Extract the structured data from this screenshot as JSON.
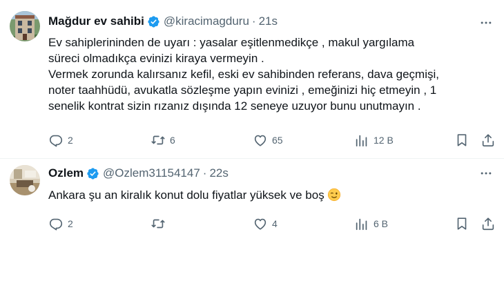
{
  "tweets": [
    {
      "name": "Mağdur ev sahibi",
      "handle": "@kiracimagduru",
      "time": "21s",
      "lines": [
        "Ev sahiplerininden de uyarı : yasalar eşitlenmedikçe , makul yargılama",
        "süreci olmadıkça evinizi kiraya vermeyin .",
        "Vermek zorunda kalırsanız kefil, eski ev sahibinden referans, dava geçmişi,",
        "noter taahhüdü, avukatla sözleşme yapın evinizi , emeğinizi hiç etmeyin , 1",
        "senelik kontrat sizin rızanız dışında 12 seneye uzuyor bunu unutmayın ."
      ],
      "replies": "2",
      "reposts": "6",
      "likes": "65",
      "views": "12 B",
      "avatar_icon": "building-avatar"
    },
    {
      "name": "Ozlem",
      "handle": "@Ozlem31154147",
      "time": "22s",
      "lines": [
        "Ankara şu an kiralık konut dolu fiyatlar yüksek ve boş"
      ],
      "emoji": "winking-face-emoji",
      "replies": "2",
      "reposts": "",
      "likes": "4",
      "views": "6 B",
      "avatar_icon": "room-avatar"
    }
  ],
  "colors": {
    "text": "#0f1419",
    "secondary": "#536471",
    "verified": "#1d9bf0",
    "divider": "#eff3f4"
  }
}
